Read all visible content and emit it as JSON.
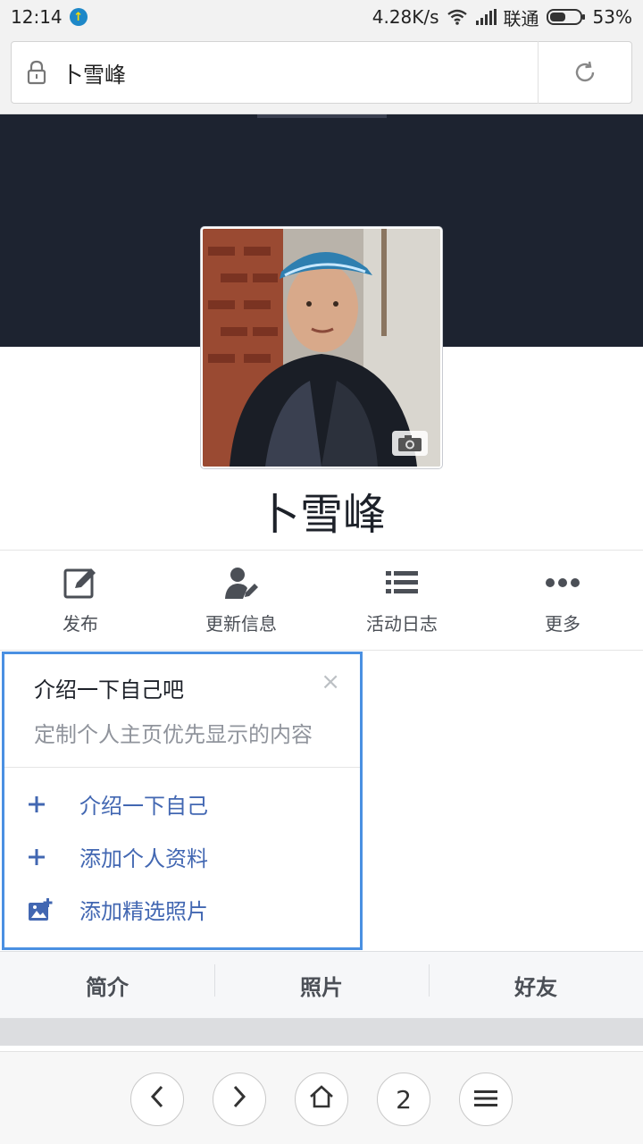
{
  "status_bar": {
    "time": "12:14",
    "network_speed": "4.28K/s",
    "carrier": "联通",
    "battery": "53%",
    "battery_level": 0.53
  },
  "url_bar": {
    "title": "卜雪峰",
    "lock_icon": "lock-icon",
    "reload_icon": "reload-icon"
  },
  "profile": {
    "name": "卜雪峰",
    "camera_icon": "camera-icon"
  },
  "actions": [
    {
      "label": "发布",
      "icon": "edit-icon"
    },
    {
      "label": "更新信息",
      "icon": "person-edit-icon"
    },
    {
      "label": "活动日志",
      "icon": "list-icon"
    },
    {
      "label": "更多",
      "icon": "more-dots-icon"
    }
  ],
  "intro_card": {
    "title": "介绍一下自己吧",
    "subtitle": "定制个人主页优先显示的内容",
    "close_glyph": "×",
    "links": [
      {
        "label": "介绍一下自己",
        "icon": "plus-icon"
      },
      {
        "label": "添加个人资料",
        "icon": "plus-icon"
      },
      {
        "label": "添加精选照片",
        "icon": "add-photo-icon"
      }
    ]
  },
  "tabs": [
    {
      "label": "简介"
    },
    {
      "label": "照片"
    },
    {
      "label": "好友"
    }
  ],
  "bottom_nav": {
    "tab_count": "2",
    "accent": "#4267b2",
    "highlight": "#4a90e2"
  }
}
